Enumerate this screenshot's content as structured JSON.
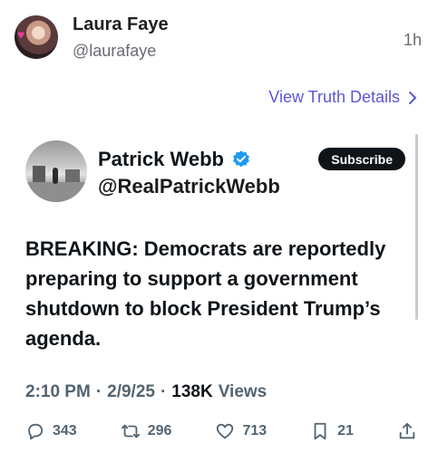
{
  "outer_post": {
    "display_name": "Laura Faye",
    "handle": "@laurafaye",
    "time": "1h",
    "view_details_label": "View Truth Details"
  },
  "embedded_post": {
    "display_name": "Patrick Webb",
    "handle": "@RealPatrickWebb",
    "subscribe_label": "Subscribe",
    "body": "BREAKING: Democrats are reportedly preparing to support a government shutdown to block President Trump’s agenda.",
    "time": "2:10 PM",
    "date": "2/9/25",
    "views_count": "138K",
    "views_label": "Views",
    "separator": "·",
    "replies": "343",
    "reposts": "296",
    "likes": "713",
    "bookmarks": "21"
  },
  "icons": {
    "verified": "verified-badge-icon",
    "reply": "reply-icon",
    "repost": "repost-icon",
    "like": "heart-icon",
    "bookmark": "bookmark-icon",
    "share": "share-icon",
    "chevron": "chevron-right-icon"
  },
  "colors": {
    "accent_link": "#5b56d6",
    "verified": "#1d9bf0",
    "muted": "#536471"
  }
}
